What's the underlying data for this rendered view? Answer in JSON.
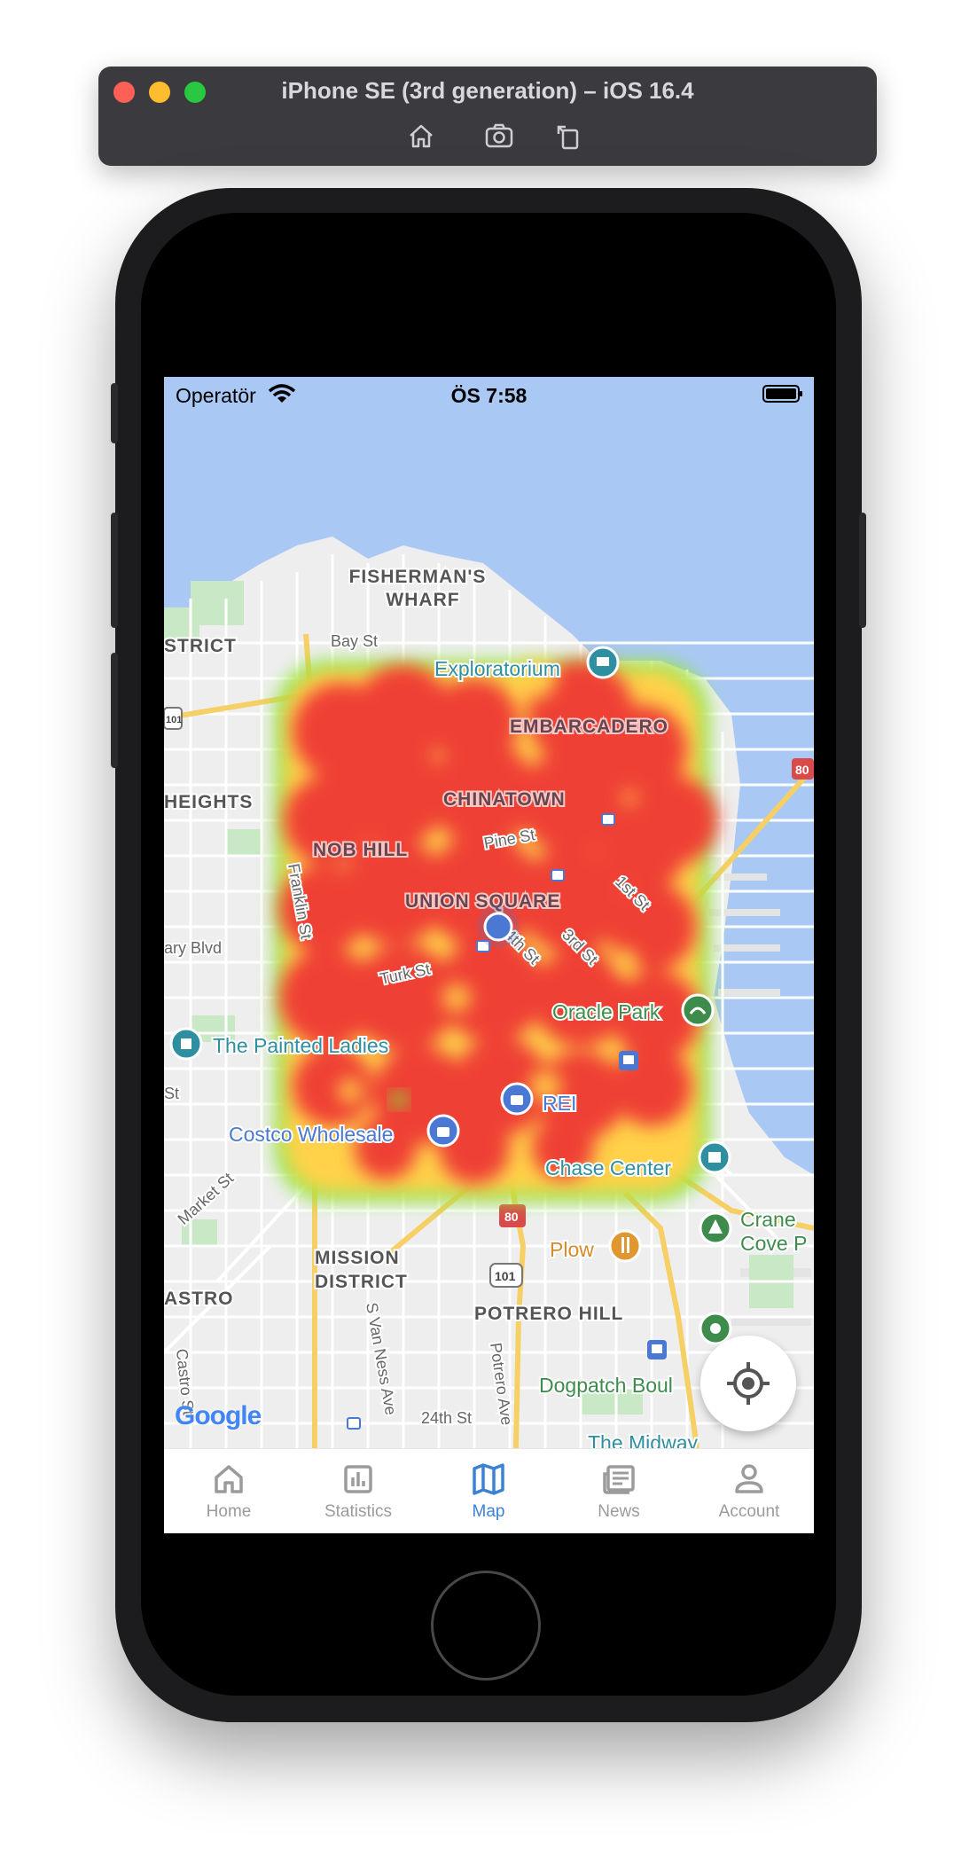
{
  "simulator": {
    "title": "iPhone SE (3rd generation) – iOS 16.4",
    "tools": [
      "home-icon",
      "screenshot-icon",
      "rotate-icon"
    ]
  },
  "status_bar": {
    "carrier": "Operatör",
    "time": "ÖS 7:58"
  },
  "map": {
    "labels": {
      "fishermans_wharf_1": "FISHERMAN'S",
      "fishermans_wharf_2": "WHARF",
      "district": "STRICT",
      "bay_st": "Bay St",
      "exploratorium": "Exploratorium",
      "embarcadero": "EMBARCADERO",
      "heights": "HEIGHTS",
      "chinatown": "CHINATOWN",
      "nob_hill": "NOB HILL",
      "pine_st": "Pine St",
      "franklin_st": "Franklin St",
      "union_square": "UNION SQUARE",
      "first_st": "1st St",
      "ary_blvd": "ary Blvd",
      "fourth_st": "4th St",
      "third_st": "3rd St",
      "turk_st": "Turk St",
      "oracle_park": "Oracle Park",
      "painted_ladies": "The Painted Ladies",
      "st": "St",
      "rei": "REI",
      "costco": "Costco Wholesale",
      "chase_center": "Chase Center",
      "crane_1": "Crane",
      "crane_2": "Cove P",
      "market_st": "Market St",
      "mission_1": "MISSION",
      "mission_2": "DISTRICT",
      "plow": "Plow",
      "astro": "ASTRO",
      "potrero_hill": "POTRERO HILL",
      "van_ness": "S Van Ness Ave",
      "potrero_ave": "Potrero Ave",
      "dogpatch": "Dogpatch Boul",
      "castro_st": "Castro St",
      "twentyfourth": "24th St",
      "midway": "The Midway",
      "shield_80": "80",
      "shield_101": "101",
      "shield_101b": "101"
    },
    "attribution": "Google",
    "heatmap_colors": {
      "high": "#ef4136",
      "mid": "#ffd24a",
      "low": "#7ee83a"
    },
    "water_color": "#aac8f4",
    "land_color": "#eeeeee"
  },
  "locate_button": {
    "icon": "gps-target-icon"
  },
  "tab_bar": {
    "active_color": "#3b82d6",
    "items": [
      {
        "label": "Home",
        "icon": "home-icon"
      },
      {
        "label": "Statistics",
        "icon": "bar-chart-icon"
      },
      {
        "label": "Map",
        "icon": "map-icon"
      },
      {
        "label": "News",
        "icon": "news-icon"
      },
      {
        "label": "Account",
        "icon": "account-icon"
      }
    ]
  }
}
